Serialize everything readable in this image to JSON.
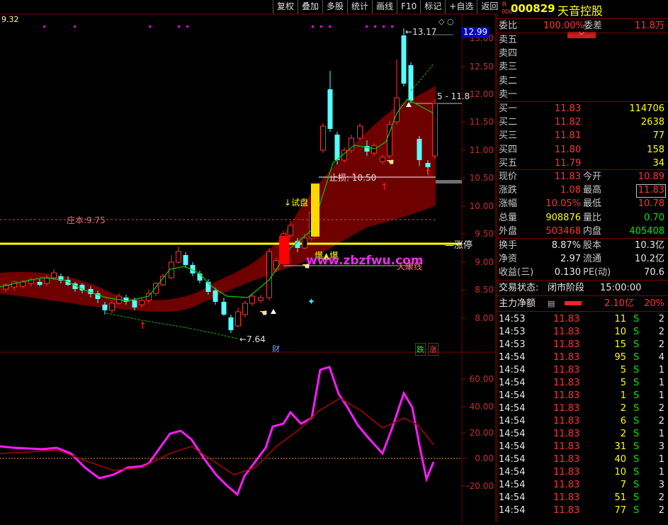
{
  "toolbar": {
    "buttons": [
      "复权",
      "叠加",
      "多股",
      "统计",
      "画线",
      "F10",
      "标记",
      "+自选",
      "返回"
    ]
  },
  "chart": {
    "top_left_value": "9.32",
    "current_price_tag": "12.99",
    "max_label": "13.17",
    "min_label": "7.64",
    "right_line_label": "11.8",
    "label_shiping": "试盘",
    "label_zhisun": "止损: 10.50",
    "label_zhuangben": "庄本:9.75",
    "label_zhangting": "涨停",
    "label_tianqi": "天康线",
    "label_baozhang": "爆▲爆",
    "watermark": "www.zbzfwu.com",
    "badge_cai": "财",
    "badge_die": "跌",
    "badge_zhang": "涨",
    "price_ticks": [
      "13.00",
      "12.50",
      "12.00",
      "11.50",
      "11.00",
      "10.50",
      "10.00",
      "9.50",
      "9.00",
      "8.50",
      "8.00"
    ],
    "osc_ticks": [
      "60.00",
      "40.00",
      "20.00",
      "0.00",
      "-20.00"
    ],
    "colors": {
      "up": "#ff3232",
      "down": "#54ffff",
      "band": "#6e0000",
      "yellow": "#ffff00",
      "magenta": "#ff1aff",
      "purple": "#b070ff"
    }
  },
  "panel": {
    "code": "000829",
    "name": "天音控股",
    "badge": "R",
    "weibi_label": "委比",
    "weibi_value": "100.00%",
    "weicha_label": "委差",
    "weicha_value": "11.8万",
    "sell": [
      {
        "label": "卖五"
      },
      {
        "label": "卖四"
      },
      {
        "label": "卖三"
      },
      {
        "label": "卖二"
      },
      {
        "label": "卖一"
      }
    ],
    "buy": [
      {
        "label": "买一",
        "price": "11.83",
        "vol": "114706"
      },
      {
        "label": "买二",
        "price": "11.82",
        "vol": "2638"
      },
      {
        "label": "买三",
        "price": "11.81",
        "vol": "77"
      },
      {
        "label": "买四",
        "price": "11.80",
        "vol": "158"
      },
      {
        "label": "买五",
        "price": "11.79",
        "vol": "34"
      }
    ],
    "stats": [
      {
        "l1": "现价",
        "v1": "11.83",
        "c1": "red",
        "l2": "今开",
        "v2": "10.89",
        "c2": "red"
      },
      {
        "l1": "涨跌",
        "v1": "1.08",
        "c1": "red",
        "l2": "最高",
        "v2": "11.83",
        "c2": "red"
      },
      {
        "l1": "涨幅",
        "v1": "10.05%",
        "c1": "red",
        "l2": "最低",
        "v2": "10.78",
        "c2": "red"
      },
      {
        "l1": "总量",
        "v1": "908876",
        "c1": "yel",
        "l2": "量比",
        "v2": "0.70",
        "c2": "grn"
      },
      {
        "l1": "外盘",
        "v1": "503468",
        "c1": "red",
        "l2": "内盘",
        "v2": "405408",
        "c2": "grn"
      }
    ],
    "fin": [
      {
        "l1": "换手",
        "v1": "8.87%",
        "l2": "股本",
        "v2": "10.3亿"
      },
      {
        "l1": "净资",
        "v1": "2.97",
        "l2": "流通",
        "v2": "10.2亿"
      },
      {
        "l1": "收益(三)",
        "v1": "0.130",
        "l2": "PE(动)",
        "v2": "70.6"
      }
    ],
    "trade_status_label": "交易状态:",
    "trade_status_value": "闭市阶段",
    "trade_status_time": "15:00:00",
    "main_net_label": "主力净额",
    "main_net_value": "2.10亿",
    "main_net_pct": "20%",
    "ticks": [
      {
        "t": "14:53",
        "p": "11.83",
        "v": "11",
        "s": "S",
        "n": "2"
      },
      {
        "t": "14:53",
        "p": "11.83",
        "v": "10",
        "s": "S",
        "n": "2"
      },
      {
        "t": "14:53",
        "p": "11.83",
        "v": "15",
        "s": "S",
        "n": "2"
      },
      {
        "t": "14:54",
        "p": "11.83",
        "v": "95",
        "s": "S",
        "n": "4"
      },
      {
        "t": "14:54",
        "p": "11.83",
        "v": "5",
        "s": "S",
        "n": "1"
      },
      {
        "t": "14:54",
        "p": "11.83",
        "v": "5",
        "s": "S",
        "n": "1"
      },
      {
        "t": "14:54",
        "p": "11.83",
        "v": "1",
        "s": "S",
        "n": "1"
      },
      {
        "t": "14:54",
        "p": "11.83",
        "v": "2",
        "s": "S",
        "n": "2"
      },
      {
        "t": "14:54",
        "p": "11.83",
        "v": "6",
        "s": "S",
        "n": "2"
      },
      {
        "t": "14:54",
        "p": "11.83",
        "v": "2",
        "s": "S",
        "n": "1"
      },
      {
        "t": "14:54",
        "p": "11.83",
        "v": "31",
        "s": "S",
        "n": "3"
      },
      {
        "t": "14:54",
        "p": "11.83",
        "v": "40",
        "s": "S",
        "n": "1"
      },
      {
        "t": "14:54",
        "p": "11.83",
        "v": "10",
        "s": "S",
        "n": "1"
      },
      {
        "t": "14:54",
        "p": "11.83",
        "v": "7",
        "s": "S",
        "n": "3"
      },
      {
        "t": "14:54",
        "p": "11.83",
        "v": "51",
        "s": "S",
        "n": "2"
      },
      {
        "t": "14:54",
        "p": "11.83",
        "v": "77",
        "s": "S",
        "n": "2"
      }
    ]
  }
}
